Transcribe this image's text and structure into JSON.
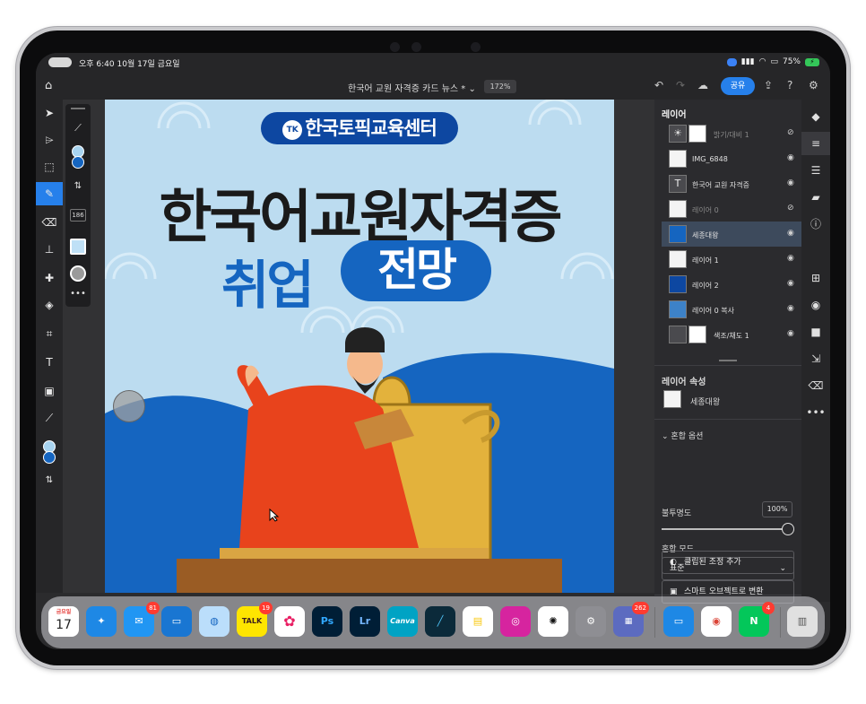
{
  "status_bar": {
    "time": "오후 6:40  10월 17일 금요일",
    "battery": "75%"
  },
  "top_bar": {
    "doc_title": "한국어 교원 자격증 카드 뉴스 *",
    "zoom": "172%",
    "share_label": "공유"
  },
  "brush_panel": {
    "size": "186"
  },
  "canvas": {
    "brand": "한국토픽교육센터",
    "brand_logo": "TK",
    "headline_line1": "한국어교원자격증",
    "headline_line2": "취업",
    "headline_pill": "전망"
  },
  "layers_panel": {
    "title": "레이어",
    "layers": [
      {
        "name": "밝기/대비 1"
      },
      {
        "name": "IMG_6848"
      },
      {
        "name": "한국어 교원 자격증"
      },
      {
        "name": "레이어 0"
      },
      {
        "name": "세종대왕"
      },
      {
        "name": "레이어 1"
      },
      {
        "name": "레이어 2"
      },
      {
        "name": "레이어 0 복사"
      },
      {
        "name": "색조/채도 1"
      }
    ]
  },
  "layer_properties": {
    "title": "레이어 속성",
    "layer_name": "세종대왕",
    "blend_options": "혼합 옵션",
    "opacity_label": "불투명도",
    "opacity_value": "100%",
    "opacity_fraction": 1.0,
    "blend_mode_label": "혼합 모드",
    "blend_mode": "표준",
    "add_clipped_adjustment": "클립된 조정 추가",
    "convert_smart_object": "스마트 오브젝트로 변환"
  },
  "dock": {
    "calendar_day_label": "금요일",
    "calendar_day": "17",
    "mail_badge": "81",
    "kakao_label": "TALK",
    "kakao_badge": "19",
    "ps_label": "Ps",
    "lr_label": "Lr",
    "canva_label": "Canva",
    "folder_badge": "262",
    "naver_label": "N",
    "naver_badge": "4"
  },
  "colors": {
    "accent": "#2680eb",
    "brand_blue": "#1565c0",
    "artboard_bg": "#bcdcf0",
    "panel_bg": "#2b2b2e"
  }
}
